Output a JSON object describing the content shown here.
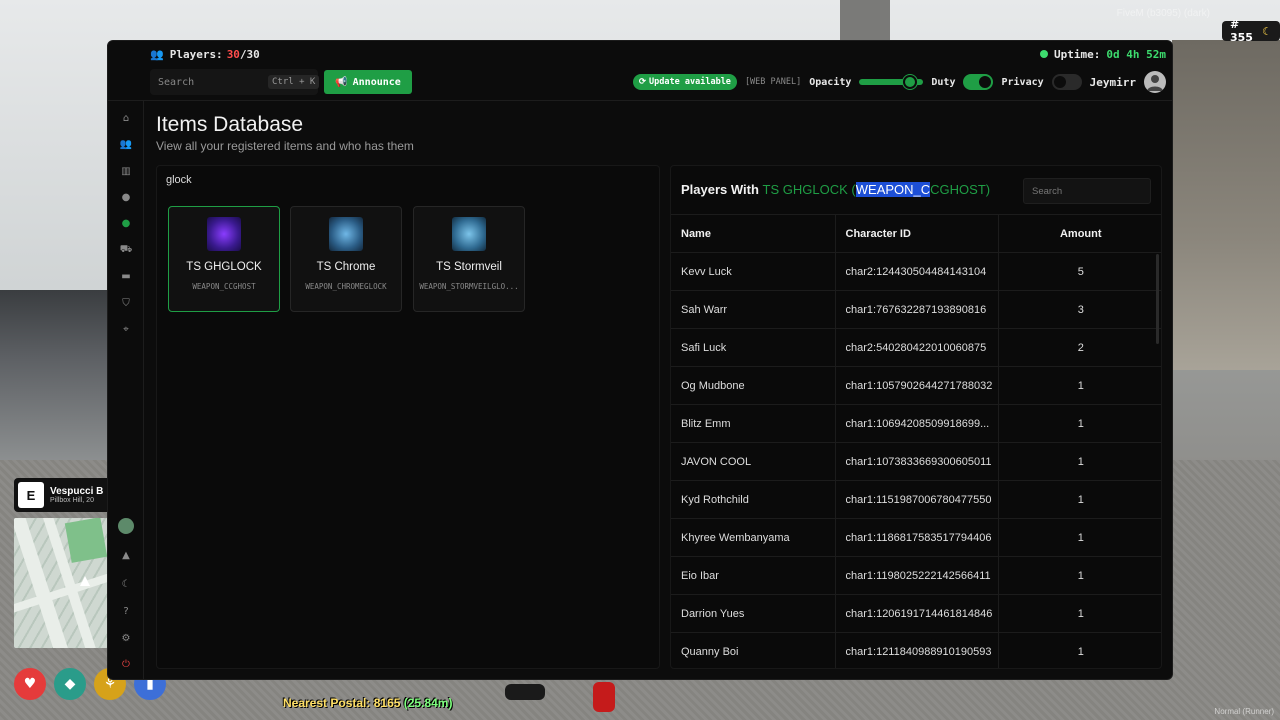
{
  "hud": {
    "fivem_tag": "FiveM (b3095) (dark)",
    "ping_label": "# 355",
    "location_key": "E",
    "street": "Vespucci B",
    "area": "Pillbox Hill, 20",
    "postal_prefix": "Nearest Postal:",
    "postal_code": "8165",
    "postal_distance": "(25.84m)",
    "corner_tag": "Normal (Runner)",
    "status_colors": [
      "#e53b3b",
      "#2a9c8a",
      "#d6a21a",
      "#3d6fd8"
    ]
  },
  "topbar": {
    "players_label": "Players:",
    "players_current": "30",
    "players_max": "/30",
    "uptime_label": "Uptime:",
    "uptime_value": "0d 4h 52m",
    "search_placeholder": "Search",
    "search_shortcut": "Ctrl + K",
    "announce_label": "Announce",
    "update_label": "Update available",
    "web_panel_label": "[WEB PANEL]",
    "opacity_label": "Opacity",
    "opacity_level": 0.88,
    "duty_label": "Duty",
    "duty_on": true,
    "privacy_label": "Privacy",
    "privacy_on": false,
    "username": "Jeymirr"
  },
  "sidebar": {
    "icons": [
      "home-icon",
      "users-icon",
      "library-icon",
      "chat-icon",
      "items-icon",
      "vehicle-icon",
      "inventory-icon",
      "shield-icon",
      "location-icon",
      "avatar-icon",
      "shapes-icon",
      "moon-icon",
      "help-icon",
      "settings-icon",
      "logout-icon"
    ]
  },
  "page": {
    "title": "Items Database",
    "subtitle": "View all your registered items and who has them"
  },
  "items": {
    "search_value": "glock",
    "list": [
      {
        "name": "TS GHGLOCK",
        "code": "WEAPON_CCGHOST",
        "selected": true
      },
      {
        "name": "TS Chrome",
        "code": "WEAPON_CHROMEGLOCK",
        "selected": false
      },
      {
        "name": "TS Stormveil",
        "code": "WEAPON_STORMVEILGLO...",
        "selected": false
      }
    ]
  },
  "players_with": {
    "prefix": "Players With",
    "item_name": "TS GHGLOCK",
    "code_open": "(",
    "code_selected": "WEAPON_C",
    "code_rest": "CGHOST)",
    "search_placeholder": "Search",
    "columns": [
      "Name",
      "Character ID",
      "Amount"
    ],
    "rows": [
      {
        "name": "Kevv Luck",
        "id": "char2:124430504484143104",
        "amount": "5"
      },
      {
        "name": "Sah Warr",
        "id": "char1:767632287193890816",
        "amount": "3"
      },
      {
        "name": "Safi Luck",
        "id": "char2:540280422010060875",
        "amount": "2"
      },
      {
        "name": "Og Mudbone",
        "id": "char1:1057902644271788032",
        "amount": "1"
      },
      {
        "name": "Blitz Emm",
        "id": "char1:10694208509918699...",
        "amount": "1"
      },
      {
        "name": "JAVON COOL",
        "id": "char1:1073833669300605011",
        "amount": "1"
      },
      {
        "name": "Kyd Rothchild",
        "id": "char1:1151987006780477550",
        "amount": "1"
      },
      {
        "name": "Khyree Wembanyama",
        "id": "char1:1186817583517794406",
        "amount": "1"
      },
      {
        "name": "Eio Ibar",
        "id": "char1:1198025222142566411",
        "amount": "1"
      },
      {
        "name": "Darrion Yues",
        "id": "char1:1206191714461814846",
        "amount": "1"
      },
      {
        "name": "Quanny Boi",
        "id": "char1:1211840988910190593",
        "amount": "1"
      }
    ]
  },
  "colors": {
    "accent": "#1f9e45",
    "panel_bg": "#0c0c0c",
    "selection": "#1d4fd6",
    "players_count": "#ff4d4d"
  }
}
